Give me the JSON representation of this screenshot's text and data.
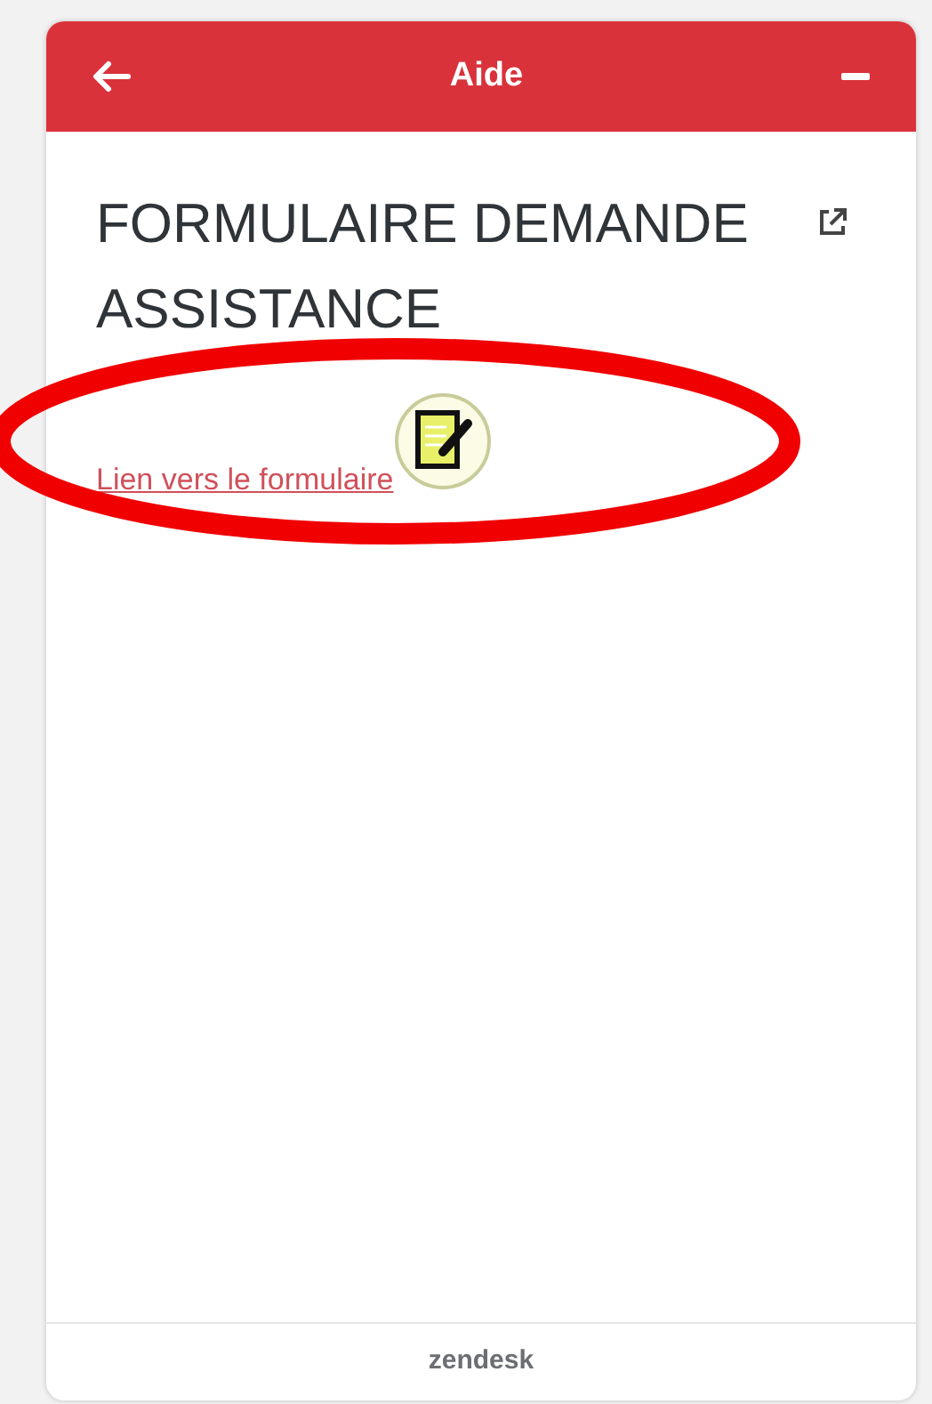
{
  "header": {
    "title": "Aide"
  },
  "article": {
    "title": "FORMULAIRE DEMANDE ASSISTANCE",
    "link": "Lien vers le formulaire"
  },
  "footer": {
    "brand": "zendesk"
  }
}
